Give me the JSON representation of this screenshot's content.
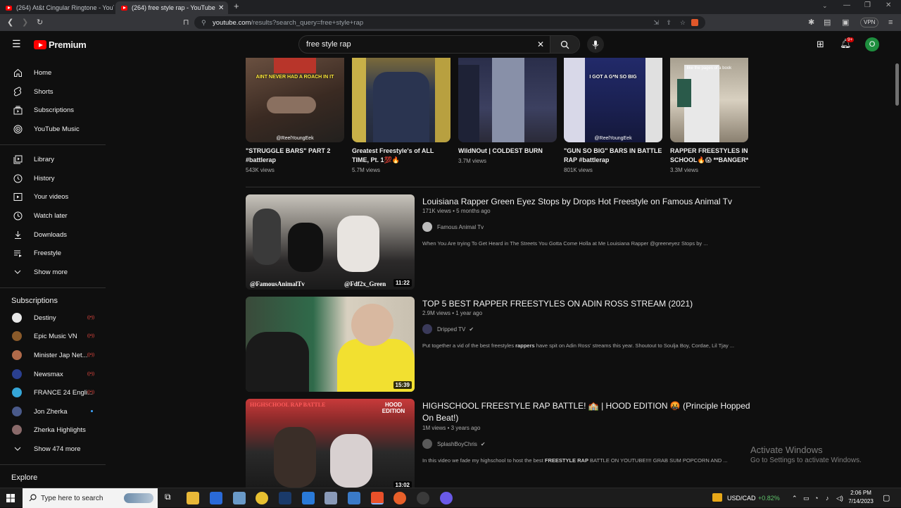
{
  "browser": {
    "tabs": [
      {
        "label": "(264) At&t Cingular Ringtone - YouTube"
      },
      {
        "label": "(264) free style rap - YouTube"
      }
    ],
    "new_tab_label": "+",
    "url_host": "youtube.com",
    "url_path": "/results?search_query=free+style+rap",
    "vpn_label": "VPN"
  },
  "youtube": {
    "brand": "Premium",
    "search_value": "free style rap",
    "notification_count": "9+",
    "avatar_letter": "O"
  },
  "sidebar": {
    "main": [
      "Home",
      "Shorts",
      "Subscriptions",
      "YouTube Music"
    ],
    "library": [
      "Library",
      "History",
      "Your videos",
      "Watch later",
      "Downloads",
      "Freestyle",
      "Show more"
    ],
    "subscriptions_heading": "Subscriptions",
    "subscriptions": [
      {
        "name": "Destiny",
        "live": true,
        "color": "#e8e8e8"
      },
      {
        "name": "Epic Music VN",
        "live": true,
        "color": "#8a5a2a"
      },
      {
        "name": "Minister Jap Net...",
        "live": true,
        "color": "#b06a4a"
      },
      {
        "name": "Newsmax",
        "live": true,
        "color": "#2a3f8f"
      },
      {
        "name": "FRANCE 24 Engli...",
        "live": true,
        "color": "#35a6d8"
      },
      {
        "name": "Jon Zherka",
        "live": false,
        "color": "#4a5a8a"
      },
      {
        "name": "Zherka Highlights",
        "live": false,
        "color": "#8a6a6a"
      }
    ],
    "show_more_subs": "Show 474 more",
    "explore_heading": "Explore"
  },
  "shorts": [
    {
      "title": "\"STRUGGLE BARS\" PART 2 #battlerap",
      "views": "543K views",
      "caption": "AINT NEVER HAD A ROACH IN IT",
      "tag": "@ReelYoungEek"
    },
    {
      "title": "Greatest Freestyle's of ALL TIME, Pt. 1💯🔥",
      "views": "5.7M views",
      "caption": "",
      "tag": ""
    },
    {
      "title": "WildNOut | COLDEST BURN",
      "views": "3.7M views",
      "caption": "",
      "tag": ""
    },
    {
      "title": "\"GUN SO BIG\" BARS IN BATTLE RAP #battlerap",
      "views": "801K views",
      "caption": "I GOT A G*N SO BIG",
      "tag": "@ReelYoungEek"
    },
    {
      "title": "RAPPER FREESTYLES IN SCHOOL🔥😱 **BANGER*",
      "views": "3.3M views",
      "caption": "",
      "tag": "like the pages of a book"
    }
  ],
  "videos": [
    {
      "title": "Louisiana Rapper Green Eyez Stops by Drops Hot Freestyle on Famous Animal Tv",
      "meta": "171K views • 5 months ago",
      "channel": "Famous Animal Tv",
      "verified": false,
      "desc": "When You Are trying To Get Heard in The Streets You Gotta Come Holla at Me Louisiana Rapper @greeneyez Stops by ...",
      "desc_bold": "",
      "duration": "11:22",
      "overlay_left": "@FamousAnimalTv",
      "overlay_right": "@Fdf2x_Green"
    },
    {
      "title": "TOP 5 BEST RAPPER FREESTYLES ON ADIN ROSS STREAM (2021)",
      "meta": "2.9M views • 1 year ago",
      "channel": "Dripped TV",
      "verified": true,
      "desc_pre": "Put together a vid of the best freestyles ",
      "desc_bold": "rappers",
      "desc_post": " have spit on Adin Ross' streams this year. Shoutout to Soulja Boy, Cordae, Lil Tjay ...",
      "duration": "15:39"
    },
    {
      "title": "HIGHSCHOOL FREESTYLE RAP BATTLE! 🏫 | HOOD EDITION 🤬 (Principle Hopped On Beat!)",
      "meta": "1M views • 3 years ago",
      "channel": "SplashBoyChris",
      "verified": true,
      "desc_pre": "In this video we fade my highschool to host the best ",
      "desc_bold": "FREESTYLE RAP",
      "desc_post": " BATTLE ON YOUTUBE!!!! GRAB SUM POPCORN AND ...",
      "duration": "13:02",
      "overlay_left": "HIGHSCHOOL RAP BATTLE",
      "overlay_right": "HOOD EDITION"
    }
  ],
  "watermark": {
    "line1": "Activate Windows",
    "line2": "Go to Settings to activate Windows."
  },
  "taskbar": {
    "search_placeholder": "Type here to search",
    "ticker": "USD/CAD",
    "ticker_change": "+0.82%",
    "time": "2:06 PM",
    "date": "7/14/2023"
  },
  "colors": {
    "youtube_red": "#ff0000",
    "accent_green": "#1e8e3e",
    "ticker_green": "#5ec26a"
  }
}
